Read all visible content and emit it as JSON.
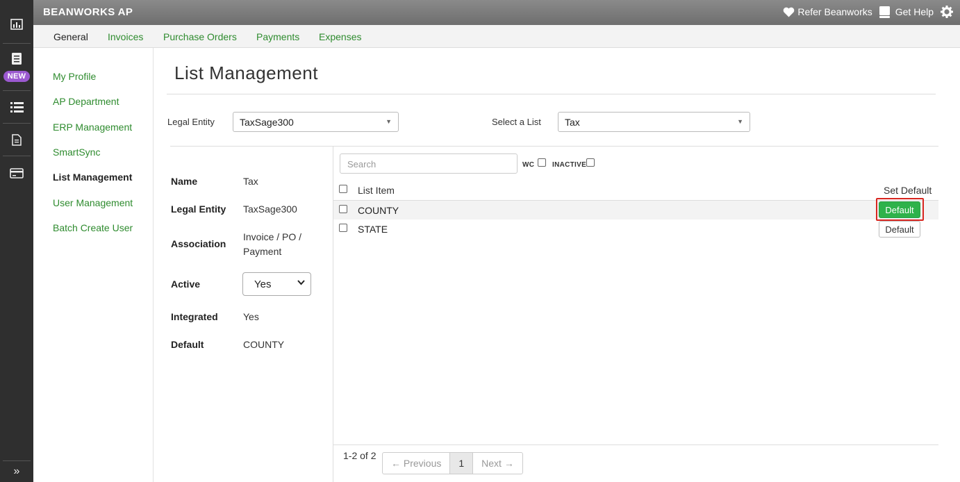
{
  "rail": {
    "new_badge": "NEW",
    "icons": [
      "bar-chart-icon",
      "ledger-icon",
      "list-icon",
      "document-icon",
      "card-icon",
      "expand-icon"
    ]
  },
  "topbar": {
    "brand": "BEANWORKS AP",
    "refer": "Refer Beanworks",
    "help": "Get Help"
  },
  "tabs": [
    {
      "label": "General",
      "active": true
    },
    {
      "label": "Invoices"
    },
    {
      "label": "Purchase Orders"
    },
    {
      "label": "Payments"
    },
    {
      "label": "Expenses"
    }
  ],
  "sidebar": {
    "items": [
      {
        "label": "My Profile"
      },
      {
        "label": "AP Department"
      },
      {
        "label": "ERP Management"
      },
      {
        "label": "SmartSync"
      },
      {
        "label": "List Management",
        "active": true
      },
      {
        "label": "User Management"
      },
      {
        "label": "Batch Create User"
      }
    ]
  },
  "main": {
    "title": "List Management",
    "legal_entity_label": "Legal Entity",
    "legal_entity_value": "TaxSage300",
    "select_list_label": "Select a List",
    "select_list_value": "Tax"
  },
  "details": {
    "name_label": "Name",
    "name_value": "Tax",
    "entity_label": "Legal Entity",
    "entity_value": "TaxSage300",
    "association_label": "Association",
    "association_value_1": "Invoice / PO /",
    "association_value_2": "Payment",
    "active_label": "Active",
    "active_value": "Yes",
    "integrated_label": "Integrated",
    "integrated_value": "Yes",
    "default_label": "Default",
    "default_value": "COUNTY"
  },
  "list": {
    "search_placeholder": "Search",
    "wc_label": "WC",
    "inactive_label": "INACTIVE",
    "col_item": "List Item",
    "col_default": "Set Default",
    "rows": [
      {
        "item": "COUNTY",
        "button": "Default",
        "is_default": true
      },
      {
        "item": "STATE",
        "button": "Default",
        "is_default": false
      }
    ],
    "count": "1-2 of 2",
    "prev": "← Previous",
    "page": "1",
    "next": "Next →"
  }
}
